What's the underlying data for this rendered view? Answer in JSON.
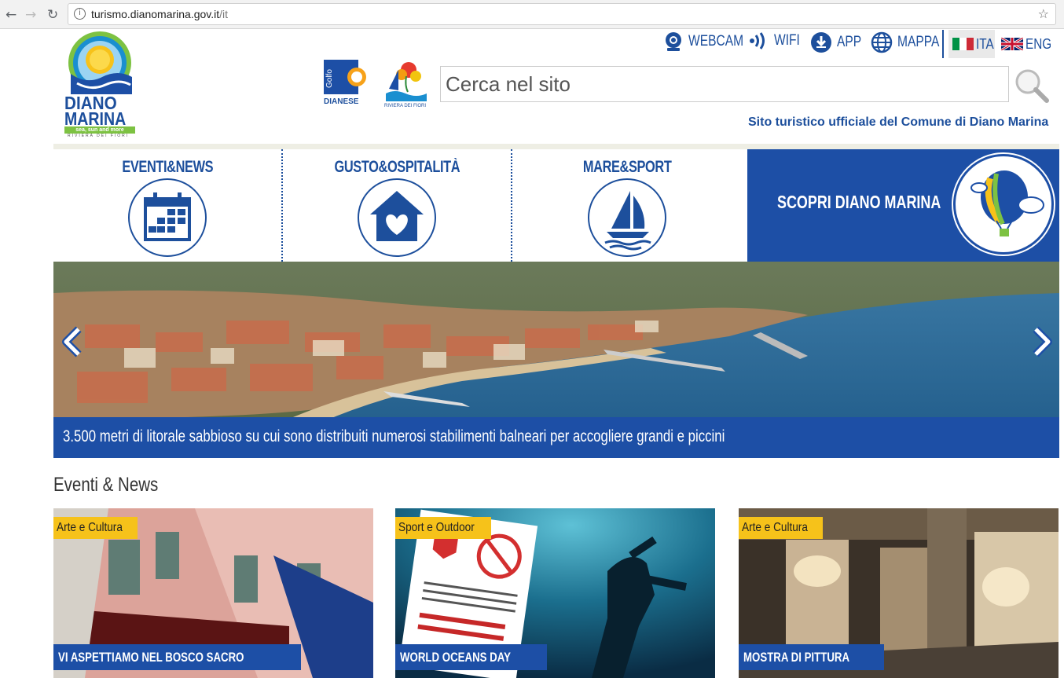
{
  "browser": {
    "url_host": "turismo.dianomarina.gov.it",
    "url_path": "/it",
    "back_icon": "←",
    "forward_icon": "→",
    "reload_icon": "↻",
    "star_icon": "☆"
  },
  "header": {
    "logo_name_1": "DIANO",
    "logo_name_2": "MARINA",
    "logo_tagline": "sea, sun and more",
    "logo_sub": "RIVIERA DEI FIORI",
    "golfo_top": "Golfo",
    "golfo_label": "DIANESE",
    "riviera_label": "RIVIERA DEI FIORI",
    "links": {
      "webcam": "WEBCAM",
      "wifi": "WIFI",
      "app": "APP",
      "mappa": "MAPPA",
      "ita": "ITA",
      "eng": "ENG"
    },
    "search_placeholder": "Cerca nel sito",
    "tagline": "Sito turistico ufficiale del Comune di Diano Marina"
  },
  "menu": {
    "items": [
      {
        "label": "EVENTI&NEWS",
        "icon": "calendar-icon"
      },
      {
        "label": "GUSTO&OSPITALITÀ",
        "icon": "house-heart-icon"
      },
      {
        "label": "MARE&SPORT",
        "icon": "sailboat-icon"
      }
    ],
    "scopri": {
      "label": "SCOPRI DIANO MARINA",
      "icon": "balloon-icon"
    }
  },
  "hero": {
    "caption": "3.500 metri di litorale sabbioso su cui sono distribuiti numerosi stabilimenti balneari per accogliere grandi e piccini"
  },
  "events": {
    "title": "Eventi & News",
    "cards": [
      {
        "category": "Arte e Cultura",
        "title": "VI ASPETTIAMO NEL BOSCO SACRO"
      },
      {
        "category": "Sport e Outdoor",
        "title": "WORLD OCEANS DAY"
      },
      {
        "category": "Arte e Cultura",
        "title": "MOSTRA DI PITTURA"
      }
    ]
  },
  "colors": {
    "brand_blue": "#1d4fa6",
    "badge_yellow": "#f6c21a"
  }
}
